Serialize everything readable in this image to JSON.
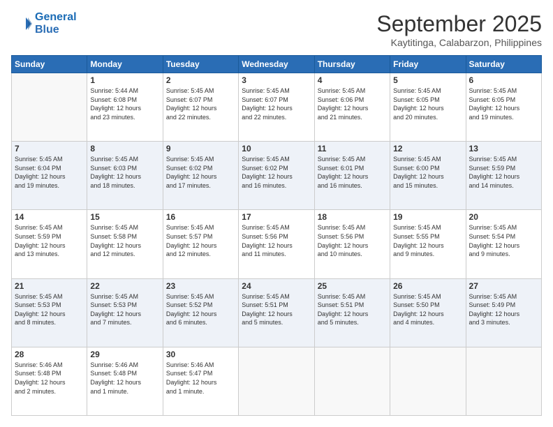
{
  "header": {
    "logo_line1": "General",
    "logo_line2": "Blue",
    "month": "September 2025",
    "location": "Kaytitinga, Calabarzon, Philippines"
  },
  "weekdays": [
    "Sunday",
    "Monday",
    "Tuesday",
    "Wednesday",
    "Thursday",
    "Friday",
    "Saturday"
  ],
  "weeks": [
    [
      {
        "day": "",
        "info": ""
      },
      {
        "day": "1",
        "info": "Sunrise: 5:44 AM\nSunset: 6:08 PM\nDaylight: 12 hours\nand 23 minutes."
      },
      {
        "day": "2",
        "info": "Sunrise: 5:45 AM\nSunset: 6:07 PM\nDaylight: 12 hours\nand 22 minutes."
      },
      {
        "day": "3",
        "info": "Sunrise: 5:45 AM\nSunset: 6:07 PM\nDaylight: 12 hours\nand 22 minutes."
      },
      {
        "day": "4",
        "info": "Sunrise: 5:45 AM\nSunset: 6:06 PM\nDaylight: 12 hours\nand 21 minutes."
      },
      {
        "day": "5",
        "info": "Sunrise: 5:45 AM\nSunset: 6:05 PM\nDaylight: 12 hours\nand 20 minutes."
      },
      {
        "day": "6",
        "info": "Sunrise: 5:45 AM\nSunset: 6:05 PM\nDaylight: 12 hours\nand 19 minutes."
      }
    ],
    [
      {
        "day": "7",
        "info": "Sunrise: 5:45 AM\nSunset: 6:04 PM\nDaylight: 12 hours\nand 19 minutes."
      },
      {
        "day": "8",
        "info": "Sunrise: 5:45 AM\nSunset: 6:03 PM\nDaylight: 12 hours\nand 18 minutes."
      },
      {
        "day": "9",
        "info": "Sunrise: 5:45 AM\nSunset: 6:02 PM\nDaylight: 12 hours\nand 17 minutes."
      },
      {
        "day": "10",
        "info": "Sunrise: 5:45 AM\nSunset: 6:02 PM\nDaylight: 12 hours\nand 16 minutes."
      },
      {
        "day": "11",
        "info": "Sunrise: 5:45 AM\nSunset: 6:01 PM\nDaylight: 12 hours\nand 16 minutes."
      },
      {
        "day": "12",
        "info": "Sunrise: 5:45 AM\nSunset: 6:00 PM\nDaylight: 12 hours\nand 15 minutes."
      },
      {
        "day": "13",
        "info": "Sunrise: 5:45 AM\nSunset: 5:59 PM\nDaylight: 12 hours\nand 14 minutes."
      }
    ],
    [
      {
        "day": "14",
        "info": "Sunrise: 5:45 AM\nSunset: 5:59 PM\nDaylight: 12 hours\nand 13 minutes."
      },
      {
        "day": "15",
        "info": "Sunrise: 5:45 AM\nSunset: 5:58 PM\nDaylight: 12 hours\nand 12 minutes."
      },
      {
        "day": "16",
        "info": "Sunrise: 5:45 AM\nSunset: 5:57 PM\nDaylight: 12 hours\nand 12 minutes."
      },
      {
        "day": "17",
        "info": "Sunrise: 5:45 AM\nSunset: 5:56 PM\nDaylight: 12 hours\nand 11 minutes."
      },
      {
        "day": "18",
        "info": "Sunrise: 5:45 AM\nSunset: 5:56 PM\nDaylight: 12 hours\nand 10 minutes."
      },
      {
        "day": "19",
        "info": "Sunrise: 5:45 AM\nSunset: 5:55 PM\nDaylight: 12 hours\nand 9 minutes."
      },
      {
        "day": "20",
        "info": "Sunrise: 5:45 AM\nSunset: 5:54 PM\nDaylight: 12 hours\nand 9 minutes."
      }
    ],
    [
      {
        "day": "21",
        "info": "Sunrise: 5:45 AM\nSunset: 5:53 PM\nDaylight: 12 hours\nand 8 minutes."
      },
      {
        "day": "22",
        "info": "Sunrise: 5:45 AM\nSunset: 5:53 PM\nDaylight: 12 hours\nand 7 minutes."
      },
      {
        "day": "23",
        "info": "Sunrise: 5:45 AM\nSunset: 5:52 PM\nDaylight: 12 hours\nand 6 minutes."
      },
      {
        "day": "24",
        "info": "Sunrise: 5:45 AM\nSunset: 5:51 PM\nDaylight: 12 hours\nand 5 minutes."
      },
      {
        "day": "25",
        "info": "Sunrise: 5:45 AM\nSunset: 5:51 PM\nDaylight: 12 hours\nand 5 minutes."
      },
      {
        "day": "26",
        "info": "Sunrise: 5:45 AM\nSunset: 5:50 PM\nDaylight: 12 hours\nand 4 minutes."
      },
      {
        "day": "27",
        "info": "Sunrise: 5:45 AM\nSunset: 5:49 PM\nDaylight: 12 hours\nand 3 minutes."
      }
    ],
    [
      {
        "day": "28",
        "info": "Sunrise: 5:46 AM\nSunset: 5:48 PM\nDaylight: 12 hours\nand 2 minutes."
      },
      {
        "day": "29",
        "info": "Sunrise: 5:46 AM\nSunset: 5:48 PM\nDaylight: 12 hours\nand 1 minute."
      },
      {
        "day": "30",
        "info": "Sunrise: 5:46 AM\nSunset: 5:47 PM\nDaylight: 12 hours\nand 1 minute."
      },
      {
        "day": "",
        "info": ""
      },
      {
        "day": "",
        "info": ""
      },
      {
        "day": "",
        "info": ""
      },
      {
        "day": "",
        "info": ""
      }
    ]
  ]
}
